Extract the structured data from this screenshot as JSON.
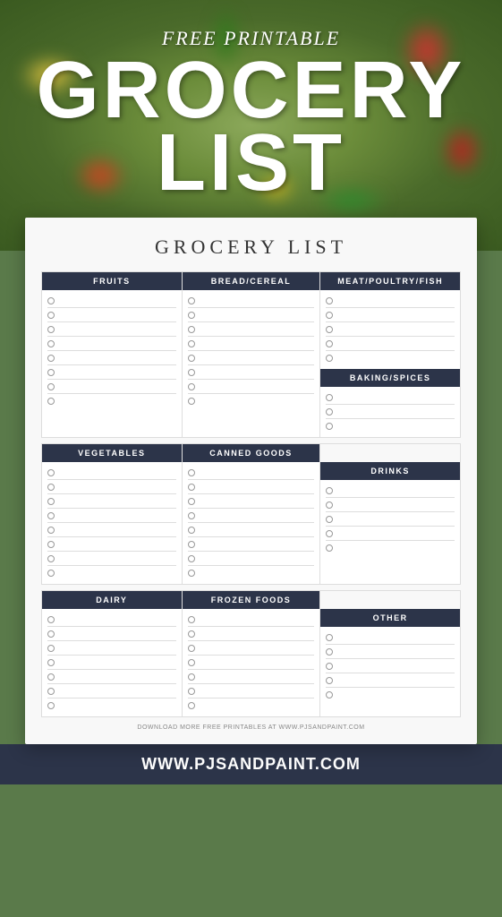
{
  "header": {
    "free_printable": "FREE PRINTABLE",
    "title_line1": "GROCERY",
    "title_line2": "LIST"
  },
  "sheet": {
    "title": "GROCERY LIST",
    "sections": {
      "fruits": "FRUITS",
      "bread_cereal": "BREAD/CEREAL",
      "meat": "MEAT/POULTRY/FISH",
      "vegetables": "VEGETABLES",
      "canned_goods": "CANNED GOODS",
      "baking_spices": "BAKING/SPICES",
      "dairy": "DAIRY",
      "frozen_foods": "FROZEN FOODS",
      "drinks": "DRINKS",
      "other": "OTHER"
    },
    "rows": 8
  },
  "footer": {
    "url": "WWW.PJSANDPAINT.COM",
    "download_note": "DOWNLOAD MORE FREE PRINTABLES AT WWW.PJSANDPAINT.COM"
  }
}
